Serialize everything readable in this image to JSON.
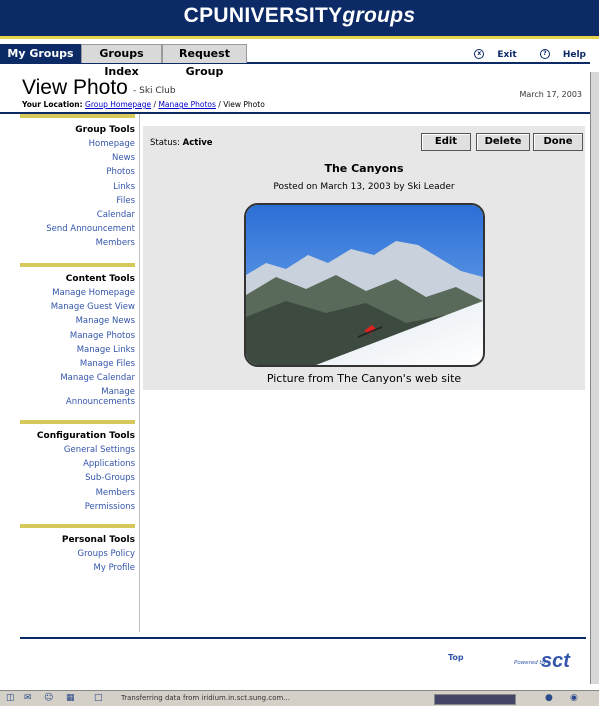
{
  "banner": {
    "prefix": "CP",
    "uni": "UNIVERSITY",
    "groups": "groups"
  },
  "tabs": [
    "My Groups",
    "Groups Index",
    "Request Group"
  ],
  "navlinks": {
    "exit": "Exit",
    "help": "Help"
  },
  "page": {
    "title": "View Photo",
    "subtitle": "- Ski Club",
    "location_label": "Your Location:",
    "crumbs": [
      "Group Homepage",
      "Manage Photos",
      "View Photo"
    ],
    "date": "March 17, 2003"
  },
  "sidebar": {
    "group_tools": {
      "heading": "Group Tools",
      "items": [
        "Homepage",
        "News",
        "Photos",
        "Links",
        "Files",
        "Calendar",
        "Send Announcement",
        "Members"
      ]
    },
    "content_tools": {
      "heading": "Content Tools",
      "items": [
        "Manage Homepage",
        "Manage Guest View",
        "Manage News",
        "Manage Photos",
        "Manage Links",
        "Manage Files",
        "Manage Calendar",
        "Manage",
        "Announcements"
      ]
    },
    "configuration_tools": {
      "heading": "Configuration Tools",
      "items": [
        "General Settings",
        "Applications",
        "Sub-Groups",
        "Members",
        "Permissions"
      ]
    },
    "personal_tools": {
      "heading": "Personal Tools",
      "items": [
        "Groups Policy",
        "My Profile"
      ]
    }
  },
  "main": {
    "status_label": "Status:",
    "status_value": "Active",
    "buttons": {
      "edit": "Edit",
      "delete": "Delete",
      "done": "Done"
    },
    "photo_title": "The Canyons",
    "posted": "Posted on March 13, 2003 by Ski Leader",
    "caption": "Picture from The Canyon's web site"
  },
  "footer": {
    "top": "Top",
    "powered": "Powered by",
    "logo": "sct"
  },
  "statusbar": {
    "text": "Transferring data from iridium.in.sct.sung.com..."
  }
}
